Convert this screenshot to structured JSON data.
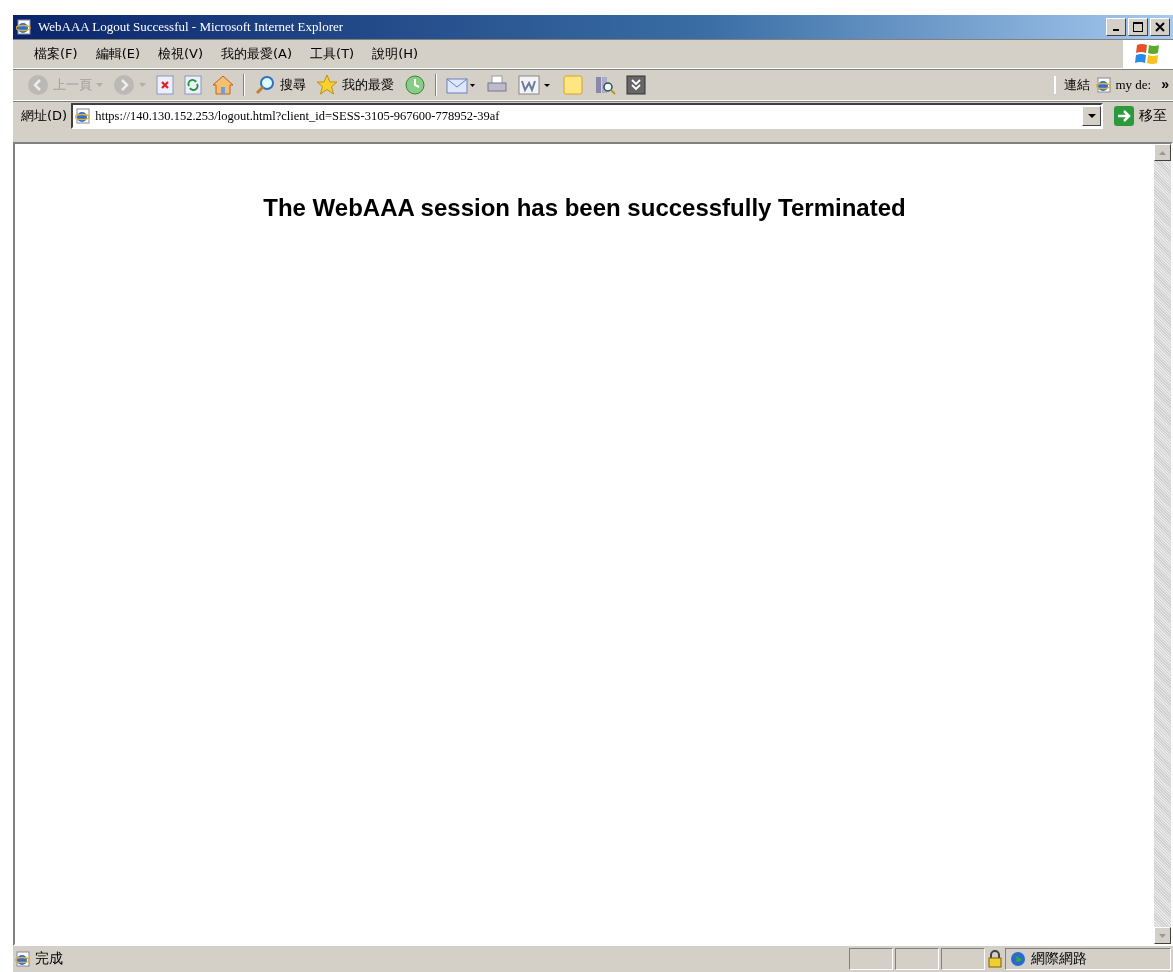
{
  "window": {
    "title": "WebAAA Logout Successful - Microsoft Internet Explorer"
  },
  "menu": [
    "檔案(F)",
    "編輯(E)",
    "檢視(V)",
    "我的最愛(A)",
    "工具(T)",
    "說明(H)"
  ],
  "toolbar": [
    {
      "kind": "back",
      "label": "上一頁",
      "disabled": true
    },
    {
      "kind": "forward",
      "disabled": true
    },
    {
      "kind": "stop",
      "disabled": false
    },
    {
      "kind": "refresh",
      "disabled": false
    },
    {
      "kind": "home",
      "disabled": false
    },
    {
      "kind": "search",
      "label": "搜尋",
      "disabled": false
    },
    {
      "kind": "favorites",
      "label": "我的最愛",
      "disabled": false
    },
    {
      "kind": "history",
      "disabled": false
    },
    {
      "kind": "mail",
      "disabled": false
    },
    {
      "kind": "print",
      "disabled": false
    },
    {
      "kind": "word",
      "disabled": false
    },
    {
      "kind": "note",
      "disabled": false
    },
    {
      "kind": "research",
      "disabled": false
    },
    {
      "kind": "more",
      "disabled": false
    }
  ],
  "links": {
    "label": "連結",
    "item": "my de:",
    "chevron": "»"
  },
  "address": {
    "label": "網址(D)",
    "value": "https://140.130.152.253/logout.html?client_id=SESS-3105-967600-778952-39af",
    "go": "移至"
  },
  "content": {
    "heading": "The WebAAA session has been successfully Terminated"
  },
  "status_bar": {
    "text": "完成",
    "zone": "網際網路"
  }
}
